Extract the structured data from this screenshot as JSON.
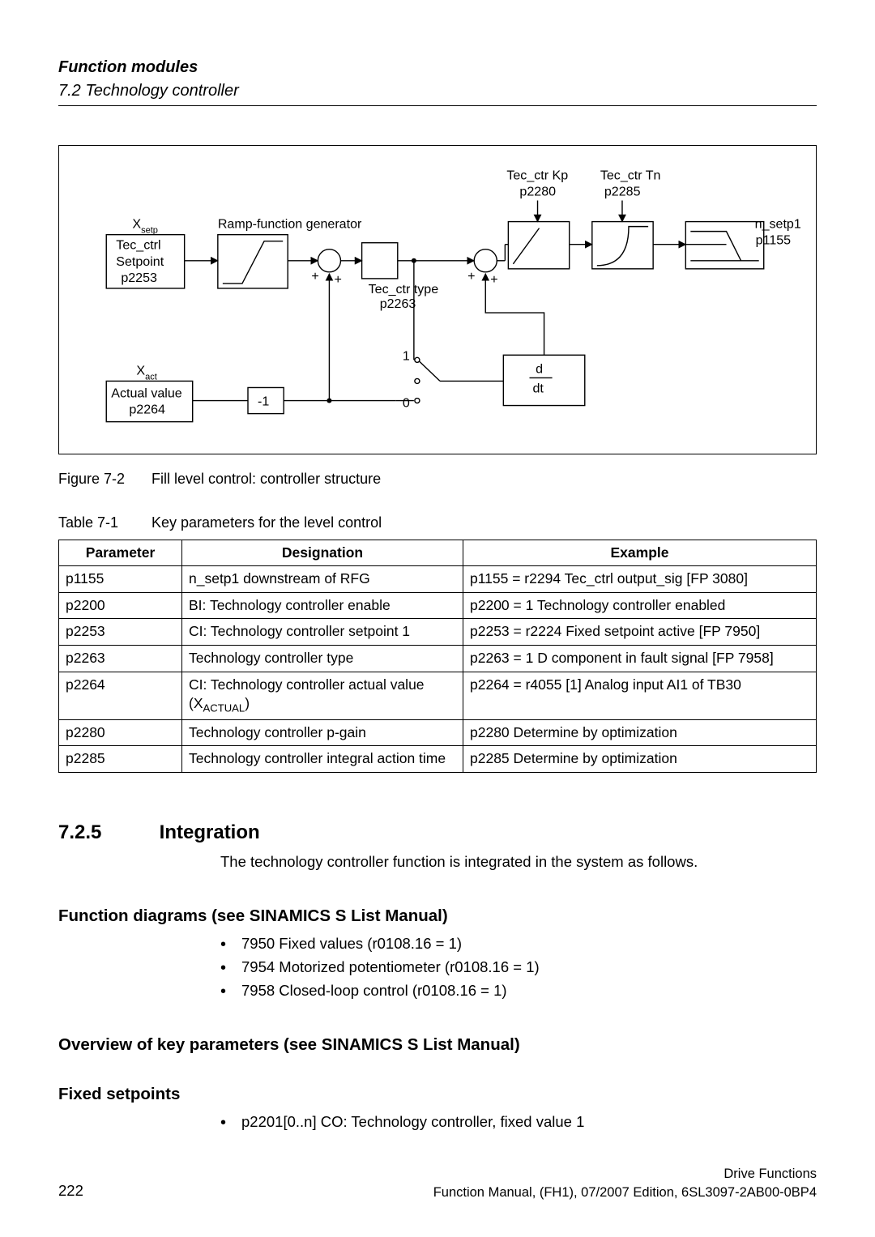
{
  "header": {
    "line1": "Function modules",
    "line2": "7.2 Technology controller"
  },
  "figure": {
    "tec_ctr_kp": "Tec_ctr Kp",
    "tec_ctr_kp_p": "p2280",
    "tec_ctr_tn": "Tec_ctr Tn",
    "tec_ctr_tn_p": "p2285",
    "x_setp": "X",
    "x_setp_sub": "setp",
    "ramp_label": "Ramp-function generator",
    "tec_ctrl_box_l1": "Tec_ctrl",
    "tec_ctrl_box_l2": "Setpoint",
    "tec_ctrl_box_l3": "p2253",
    "plus1": "+",
    "plus2": "+",
    "plus3": "+",
    "plus4": "+",
    "tec_ctr_type": "Tec_ctr type",
    "tec_ctr_type_p": "p2263",
    "n_setp1": "n_setp1",
    "n_setp1_p": "p1155",
    "one": "1",
    "zero": "0",
    "d": "d",
    "dt": "dt",
    "neg1": "-1",
    "x_act": "X",
    "x_act_sub": "act",
    "actual_value": "Actual value",
    "actual_value_p": "p2264"
  },
  "fig_caption_lead": "Figure 7-2",
  "fig_caption_text": "Fill level control: controller structure",
  "tbl_caption_lead": "Table 7-1",
  "tbl_caption_text": "Key parameters for the level control",
  "table": {
    "h_param": "Parameter",
    "h_desig": "Designation",
    "h_example": "Example",
    "rows": [
      {
        "p": "p1155",
        "d": "n_setp1 downstream of RFG",
        "e": "p1155 = r2294 Tec_ctrl output_sig [FP 3080]"
      },
      {
        "p": "p2200",
        "d": "BI: Technology controller enable",
        "e": "p2200 = 1 Technology controller enabled"
      },
      {
        "p": "p2253",
        "d": "CI: Technology controller setpoint 1",
        "e": "p2253 = r2224 Fixed setpoint active [FP 7950]"
      },
      {
        "p": "p2263",
        "d": "Technology controller type",
        "e": "p2263 = 1 D component in fault signal [FP 7958]"
      },
      {
        "p": "p2264",
        "d": "CI: Technology controller actual value (Xᴀᴄᴛᴜᴀʟ)",
        "e": "p2264 = r4055 [1] Analog input AI1 of TB30"
      },
      {
        "p": "p2280",
        "d": "Technology controller p-gain",
        "e": "p2280 Determine by optimization"
      },
      {
        "p": "p2285",
        "d": "Technology controller integral action time",
        "e": "p2285 Determine by optimization"
      }
    ]
  },
  "sec725_num": "7.2.5",
  "sec725_title": "Integration",
  "sec725_body": "The technology controller function is integrated in the system as follows.",
  "fd_heading": "Function diagrams (see SINAMICS S List Manual)",
  "fd_items": [
    "7950 Fixed values (r0108.16 = 1)",
    "7954 Motorized potentiometer (r0108.16 = 1)",
    "7958 Closed-loop control (r0108.16 = 1)"
  ],
  "ovk_heading": "Overview of key parameters (see SINAMICS S List Manual)",
  "fs_heading": "Fixed setpoints",
  "fs_items": [
    "p2201[0..n] CO: Technology controller, fixed value 1"
  ],
  "footer": {
    "page": "222",
    "r1": "Drive Functions",
    "r2": "Function Manual, (FH1), 07/2007 Edition, 6SL3097-2AB00-0BP4"
  }
}
